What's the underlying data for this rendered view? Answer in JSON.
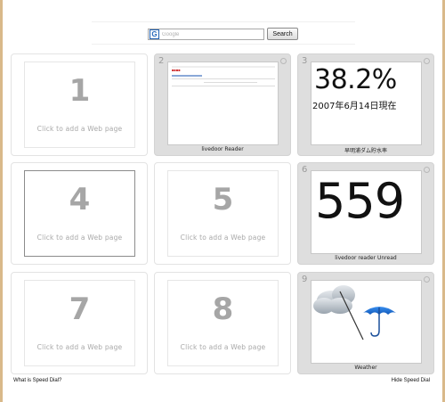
{
  "search": {
    "placeholder": "Google",
    "button_label": "Search",
    "engine_icon": "google-icon"
  },
  "dials": [
    {
      "slot": "1",
      "hint": "Click to add a Web page"
    },
    {
      "slot": "2",
      "caption": "livedoor Reader"
    },
    {
      "slot": "3",
      "big": "38.2%",
      "sub": "2007年6月14日現在",
      "caption": "早明浦ダム貯水率"
    },
    {
      "slot": "4",
      "hint": "Click to add a Web page"
    },
    {
      "slot": "5",
      "hint": "Click to add a Web page"
    },
    {
      "slot": "6",
      "big": "559",
      "caption": "livedoor reader Unread"
    },
    {
      "slot": "7",
      "hint": "Click to add a Web page"
    },
    {
      "slot": "8",
      "hint": "Click to add a Web page"
    },
    {
      "slot": "9",
      "caption": "Weather",
      "icon": "cloud-umbrella-icon"
    }
  ],
  "footer": {
    "left_link": "What is Speed Dial?",
    "right_link": "Hide Speed Dial"
  },
  "colors": {
    "frame": "#d9b98a",
    "umbrella": "#1a6fcf"
  }
}
